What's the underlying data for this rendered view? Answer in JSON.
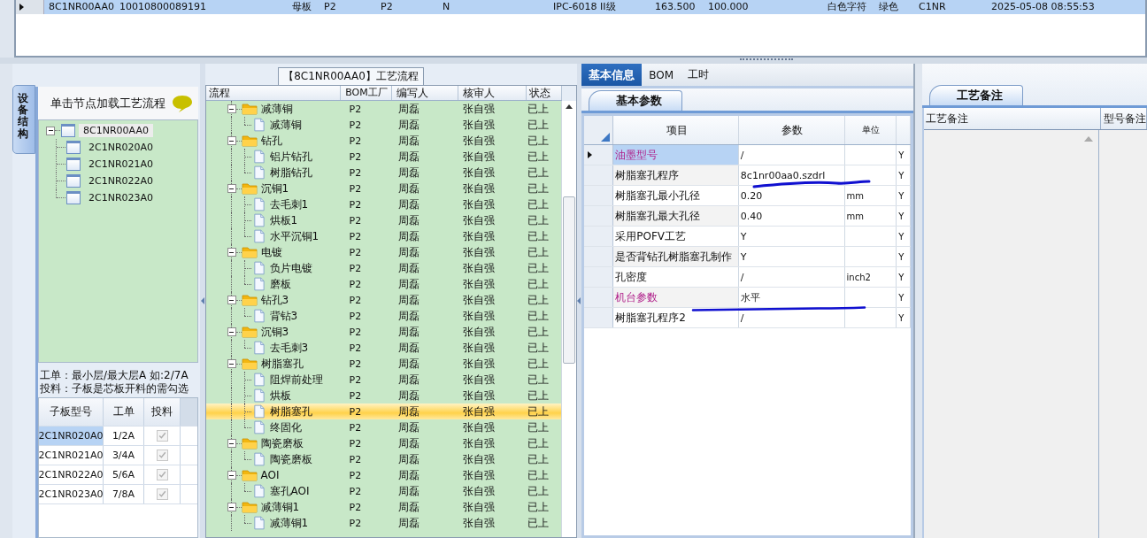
{
  "record_row": {
    "selected": true,
    "cells": [
      "8C1NR00AA0",
      "10010800089191",
      "母板",
      "P2",
      "P2",
      "N",
      "IPC-6018 II级",
      "163.500",
      "100.000",
      "白色字符",
      "绿色",
      "C1NR",
      "2025-05-08 08:55:53"
    ]
  },
  "left_panel": {
    "tab": "设备结构",
    "hint": "单击节点加载工艺流程",
    "tree": [
      {
        "label": "8C1NR00AA0",
        "expanded": true,
        "selected": true,
        "children": [
          {
            "label": "2C1NR020A0",
            "selected": false
          },
          {
            "label": "2C1NR021A0",
            "selected": false
          },
          {
            "label": "2C1NR022A0",
            "selected": false
          },
          {
            "label": "2C1NR023A0",
            "selected": false
          }
        ]
      }
    ],
    "notes": [
      "工单：最小层/最大层A 如:2/7A",
      "投料：子板是芯板开料的需勾选"
    ],
    "sub_table": {
      "columns": [
        "子板型号",
        "工单",
        "投料"
      ],
      "rows": [
        {
          "model": "2C1NR020A0",
          "order": "1/2A",
          "feed": true,
          "selected": true
        },
        {
          "model": "2C1NR021A0",
          "order": "3/4A",
          "feed": true,
          "selected": false
        },
        {
          "model": "2C1NR022A0",
          "order": "5/6A",
          "feed": true,
          "selected": false
        },
        {
          "model": "2C1NR023A0",
          "order": "7/8A",
          "feed": true,
          "selected": false
        }
      ]
    }
  },
  "process_panel": {
    "title": "【8C1NR00AA0】工艺流程",
    "columns": [
      "流程",
      "BOM工厂",
      "编写人",
      "核审人",
      "状态"
    ],
    "steps": [
      {
        "name": "减薄铜",
        "bom": "P2",
        "writer": "周磊",
        "reviewer": "张自强",
        "status": "已上",
        "expanded": true,
        "selected": false,
        "children": [
          {
            "name": "减薄铜",
            "bom": "P2",
            "writer": "周磊",
            "reviewer": "张自强",
            "status": "已上",
            "selected": false
          }
        ]
      },
      {
        "name": "钻孔",
        "bom": "P2",
        "writer": "周磊",
        "reviewer": "张自强",
        "status": "已上",
        "expanded": true,
        "selected": false,
        "children": [
          {
            "name": "铝片钻孔",
            "bom": "P2",
            "writer": "周磊",
            "reviewer": "张自强",
            "status": "已上",
            "selected": false
          },
          {
            "name": "树脂钻孔",
            "bom": "P2",
            "writer": "周磊",
            "reviewer": "张自强",
            "status": "已上",
            "selected": false
          }
        ]
      },
      {
        "name": "沉铜1",
        "bom": "P2",
        "writer": "周磊",
        "reviewer": "张自强",
        "status": "已上",
        "expanded": true,
        "selected": false,
        "children": [
          {
            "name": "去毛刺1",
            "bom": "P2",
            "writer": "周磊",
            "reviewer": "张自强",
            "status": "已上",
            "selected": false
          },
          {
            "name": "烘板1",
            "bom": "P2",
            "writer": "周磊",
            "reviewer": "张自强",
            "status": "已上",
            "selected": false
          },
          {
            "name": "水平沉铜1",
            "bom": "P2",
            "writer": "周磊",
            "reviewer": "张自强",
            "status": "已上",
            "selected": false
          }
        ]
      },
      {
        "name": "电镀",
        "bom": "P2",
        "writer": "周磊",
        "reviewer": "张自强",
        "status": "已上",
        "expanded": true,
        "selected": false,
        "children": [
          {
            "name": "负片电镀",
            "bom": "P2",
            "writer": "周磊",
            "reviewer": "张自强",
            "status": "已上",
            "selected": false
          },
          {
            "name": "磨板",
            "bom": "P2",
            "writer": "周磊",
            "reviewer": "张自强",
            "status": "已上",
            "selected": false
          }
        ]
      },
      {
        "name": "钻孔3",
        "bom": "P2",
        "writer": "周磊",
        "reviewer": "张自强",
        "status": "已上",
        "expanded": true,
        "selected": false,
        "children": [
          {
            "name": "背钻3",
            "bom": "P2",
            "writer": "周磊",
            "reviewer": "张自强",
            "status": "已上",
            "selected": false
          }
        ]
      },
      {
        "name": "沉铜3",
        "bom": "P2",
        "writer": "周磊",
        "reviewer": "张自强",
        "status": "已上",
        "expanded": true,
        "selected": false,
        "children": [
          {
            "name": "去毛刺3",
            "bom": "P2",
            "writer": "周磊",
            "reviewer": "张自强",
            "status": "已上",
            "selected": false
          }
        ]
      },
      {
        "name": "树脂塞孔",
        "bom": "P2",
        "writer": "周磊",
        "reviewer": "张自强",
        "status": "已上",
        "expanded": true,
        "selected": false,
        "children": [
          {
            "name": "阻焊前处理",
            "bom": "P2",
            "writer": "周磊",
            "reviewer": "张自强",
            "status": "已上",
            "selected": false
          },
          {
            "name": "烘板",
            "bom": "P2",
            "writer": "周磊",
            "reviewer": "张自强",
            "status": "已上",
            "selected": false
          },
          {
            "name": "树脂塞孔",
            "bom": "P2",
            "writer": "周磊",
            "reviewer": "张自强",
            "status": "已上",
            "selected": true
          },
          {
            "name": "终固化",
            "bom": "P2",
            "writer": "周磊",
            "reviewer": "张自强",
            "status": "已上",
            "selected": false
          }
        ]
      },
      {
        "name": "陶瓷磨板",
        "bom": "P2",
        "writer": "周磊",
        "reviewer": "张自强",
        "status": "已上",
        "expanded": true,
        "selected": false,
        "children": [
          {
            "name": "陶瓷磨板",
            "bom": "P2",
            "writer": "周磊",
            "reviewer": "张自强",
            "status": "已上",
            "selected": false
          }
        ]
      },
      {
        "name": "AOI",
        "bom": "P2",
        "writer": "周磊",
        "reviewer": "张自强",
        "status": "已上",
        "expanded": true,
        "selected": false,
        "children": [
          {
            "name": "塞孔AOI",
            "bom": "P2",
            "writer": "周磊",
            "reviewer": "张自强",
            "status": "已上",
            "selected": false
          }
        ]
      },
      {
        "name": "减薄铜1",
        "bom": "P2",
        "writer": "周磊",
        "reviewer": "张自强",
        "status": "已上",
        "expanded": true,
        "selected": false,
        "children": [
          {
            "name": "减薄铜1",
            "bom": "P2",
            "writer": "周磊",
            "reviewer": "张自强",
            "status": "已上",
            "selected": false
          }
        ]
      }
    ]
  },
  "info_panel": {
    "tabs": [
      {
        "label": "基本信息",
        "selected": true
      },
      {
        "label": "BOM",
        "selected": false
      },
      {
        "label": "工时",
        "selected": false
      }
    ],
    "subtab": "基本参数",
    "columns": [
      "项目",
      "参数",
      "单位"
    ],
    "rows": [
      {
        "item": "油墨型号",
        "value": "/",
        "flag": "Y",
        "kind": "choice",
        "selected": true
      },
      {
        "item": "树脂塞孔程序",
        "value": "8c1nr00aa0.szdrl",
        "flag": "Y",
        "kind": "text",
        "selected": false
      },
      {
        "item": "树脂塞孔最小孔径",
        "value": "0.20",
        "unit": "mm",
        "flag": "Y",
        "kind": "text",
        "selected": false
      },
      {
        "item": "树脂塞孔最大孔径",
        "value": "0.40",
        "unit": "mm",
        "flag": "Y",
        "kind": "text",
        "selected": false
      },
      {
        "item": "采用POFV工艺",
        "value": "Y",
        "flag": "Y",
        "kind": "text",
        "selected": false
      },
      {
        "item": "是否背钻孔树脂塞孔制作",
        "value": "Y",
        "flag": "Y",
        "kind": "text",
        "selected": false
      },
      {
        "item": "孔密度",
        "value": "/",
        "unit": "inch2",
        "flag": "Y",
        "kind": "text",
        "selected": false
      },
      {
        "item": "机台参数",
        "value": "水平",
        "flag": "Y",
        "kind": "choice",
        "selected": false
      },
      {
        "item": "树脂塞孔程序2",
        "value": "/",
        "flag": "Y",
        "kind": "text",
        "selected": false
      }
    ]
  },
  "remark_panel": {
    "tab": "工艺备注",
    "columns": [
      "工艺备注",
      "型号备注"
    ]
  }
}
